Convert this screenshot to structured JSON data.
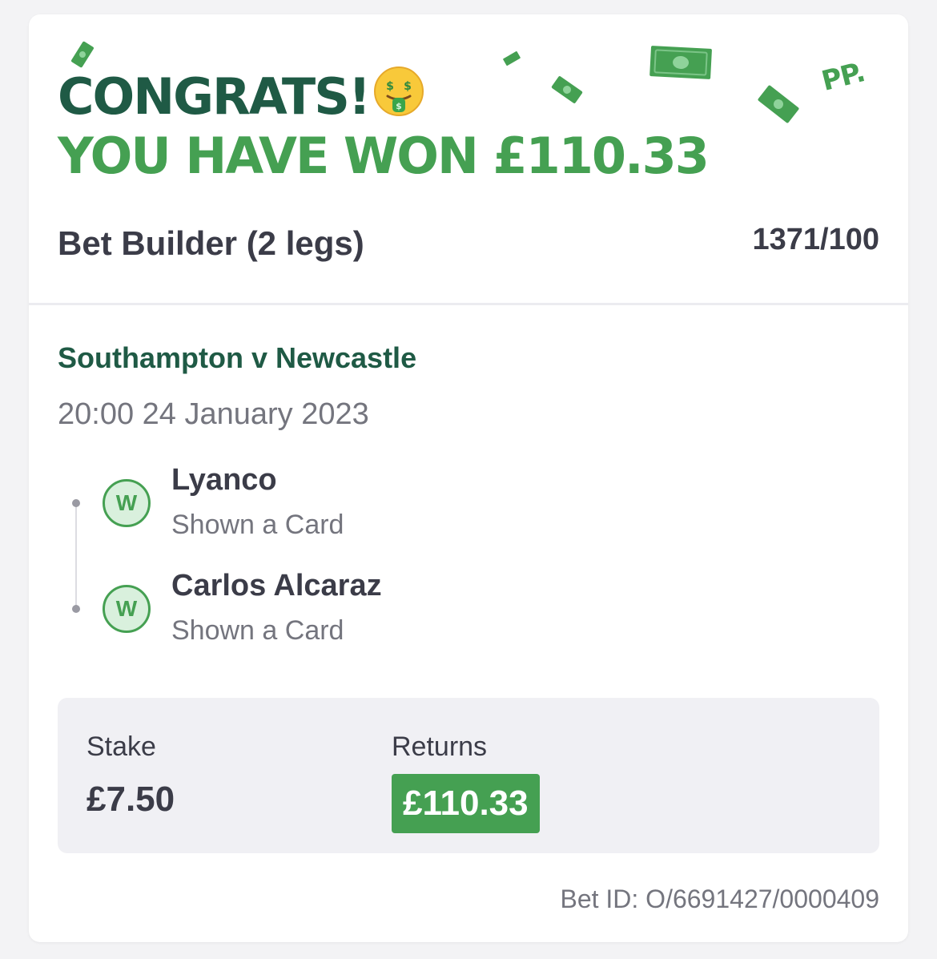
{
  "header": {
    "headline": "CONGRATS!",
    "subheadline": "YOU HAVE WON £110.33",
    "emoji_icon": "money-mouth-face-icon",
    "brand_logo": "PP.",
    "decoration_icon": "banknote-icon"
  },
  "bet": {
    "type": "Bet Builder (2 legs)",
    "odds": "1371/100"
  },
  "event": {
    "name": "Southampton v Newcastle",
    "datetime": "20:00 24 January 2023"
  },
  "legs": [
    {
      "status": "W",
      "selection": "Lyanco",
      "market": "Shown a Card"
    },
    {
      "status": "W",
      "selection": "Carlos Alcaraz",
      "market": "Shown a Card"
    }
  ],
  "summary": {
    "stake_label": "Stake",
    "stake_value": "£7.50",
    "returns_label": "Returns",
    "returns_value": "£110.33"
  },
  "bet_id": "Bet ID: O/6691427/0000409",
  "colors": {
    "dark_green": "#1f5a45",
    "accent_green": "#45a052",
    "text_dark": "#3b3c48",
    "text_muted": "#74757e"
  }
}
